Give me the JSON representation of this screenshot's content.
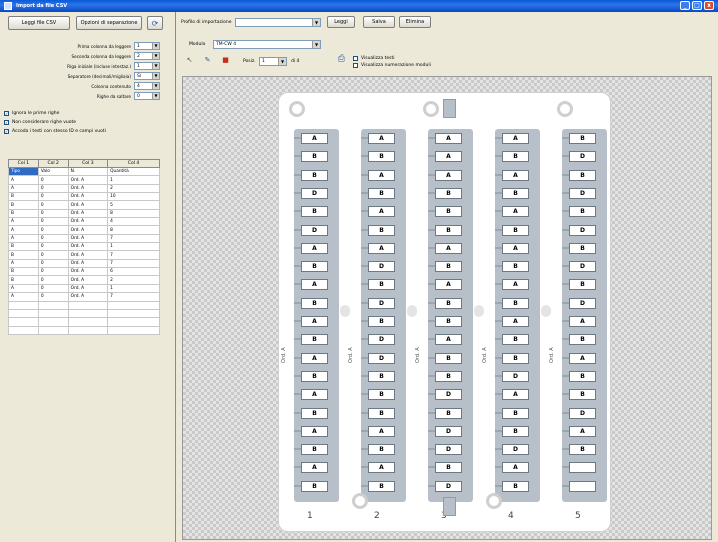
{
  "window": {
    "title": "Import da file CSV",
    "buttons": [
      "_",
      "□",
      "x"
    ]
  },
  "left_toolbar": {
    "load_csv": "Leggi file CSV",
    "grid_settings": "Opzioni di separazione"
  },
  "settings": [
    {
      "label": "Prima colonna da leggere",
      "value": "1"
    },
    {
      "label": "Seconda colonna da leggere",
      "value": "2"
    },
    {
      "label": "Riga iniziale (incluse intestaz.)",
      "value": "1"
    },
    {
      "label": "Separatore (decimali/migliaia)",
      "value": "Sì"
    },
    {
      "label": "Colonna contenuto",
      "value": "4"
    },
    {
      "label": "Righe da saltare",
      "value": "0"
    }
  ],
  "checkboxes": [
    {
      "label": "Ignora le prime righe",
      "checked": true
    },
    {
      "label": "Non considerare righe vuote",
      "checked": true
    },
    {
      "label": "Accoda i testi con stesso ID e campi vuoti",
      "checked": true
    }
  ],
  "grid": {
    "headers": [
      "Col 1",
      "Col 2",
      "Col 3",
      "Col 4"
    ],
    "rows": [
      [
        "Tipo",
        "Valo",
        "N.",
        "Quantità"
      ],
      [
        "A",
        "0",
        "Ord. A",
        "1"
      ],
      [
        "A",
        "0",
        "Ord. A",
        "2"
      ],
      [
        "B",
        "0",
        "Ord. A",
        "10"
      ],
      [
        "B",
        "0",
        "Ord. A",
        "5"
      ],
      [
        "B",
        "0",
        "Ord. A",
        "8"
      ],
      [
        "A",
        "0",
        "Ord. A",
        "4"
      ],
      [
        "A",
        "0",
        "Ord. A",
        "8"
      ],
      [
        "A",
        "0",
        "Ord. A",
        "7"
      ],
      [
        "B",
        "0",
        "Ord. A",
        "1"
      ],
      [
        "B",
        "0",
        "Ord. A",
        "7"
      ],
      [
        "A",
        "0",
        "Ord. A",
        "7"
      ],
      [
        "B",
        "0",
        "Ord. A",
        "6"
      ],
      [
        "B",
        "0",
        "Ord. A",
        "2"
      ],
      [
        "A",
        "0",
        "Ord. A",
        "1"
      ],
      [
        "A",
        "0",
        "Ord. A",
        "7"
      ]
    ]
  },
  "top_toolbar": {
    "profile_label": "Profilo di importazione",
    "profile_value": "",
    "load": "Leggi",
    "save": "Salva",
    "delete": "Elimina",
    "module_label": "Modulo",
    "module_value": "TM-CW 4",
    "position_label": "Posiz.",
    "position_value": "1",
    "of_label": "di 4",
    "opt1": "Visualizza testi",
    "opt2": "Visualizza numerazione moduli"
  },
  "canvas": {
    "side_label": "Ord. A",
    "sheets": [
      {
        "number": "1",
        "cells": [
          "A",
          "B",
          "B",
          "D",
          "B",
          "D",
          "A",
          "B",
          "A",
          "B",
          "A",
          "B",
          "A",
          "B",
          "A",
          "B",
          "A",
          "B",
          "A",
          "B"
        ]
      },
      {
        "number": "2",
        "cells": [
          "A",
          "B",
          "A",
          "B",
          "A",
          "B",
          "A",
          "D",
          "B",
          "D",
          "B",
          "D",
          "D",
          "B",
          "B",
          "B",
          "A",
          "B",
          "A",
          "B"
        ]
      },
      {
        "number": "3",
        "cells": [
          "A",
          "A",
          "A",
          "B",
          "B",
          "B",
          "A",
          "B",
          "A",
          "B",
          "B",
          "A",
          "B",
          "B",
          "D",
          "B",
          "D",
          "D",
          "B",
          "D"
        ]
      },
      {
        "number": "4",
        "cells": [
          "A",
          "B",
          "A",
          "B",
          "A",
          "B",
          "A",
          "B",
          "A",
          "B",
          "A",
          "B",
          "B",
          "D",
          "A",
          "B",
          "B",
          "D",
          "A",
          "B"
        ]
      },
      {
        "number": "5",
        "cells": [
          "B",
          "D",
          "B",
          "D",
          "B",
          "D",
          "B",
          "D",
          "B",
          "D",
          "A",
          "B",
          "A",
          "B",
          "B",
          "D",
          "A",
          "B",
          "",
          ""
        ]
      }
    ]
  }
}
